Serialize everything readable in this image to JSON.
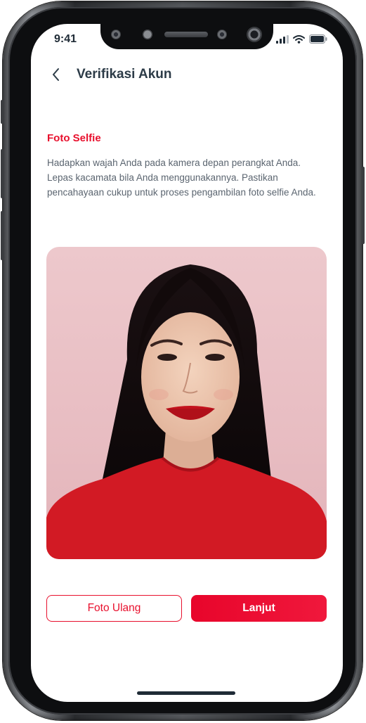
{
  "status_bar": {
    "time": "9:41"
  },
  "header": {
    "title": "Verifikasi Akun",
    "back_icon": "chevron-left-icon"
  },
  "section": {
    "title": "Foto Selfie",
    "description": "Hadapkan wajah Anda pada kamera depan perangkat Anda. Lepas kacamata bila Anda menggunakannya. Pastikan pencahayaan cukup untuk proses pengambilan foto selfie Anda."
  },
  "buttons": {
    "retake_label": "Foto Ulang",
    "next_label": "Lanjut"
  },
  "colors": {
    "accent": "#e8102d",
    "title_text": "#2c3b47",
    "body_text": "#5b6570",
    "photo_background": "#edc8cc",
    "sweater": "#d21a24"
  }
}
